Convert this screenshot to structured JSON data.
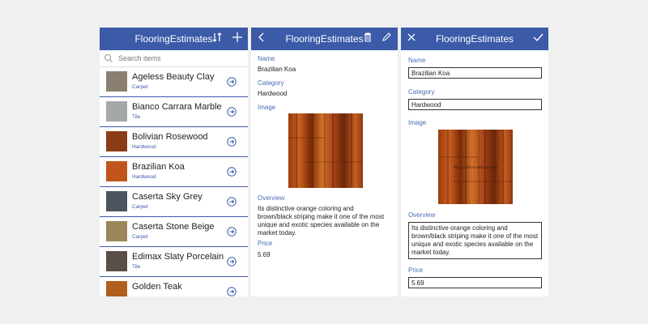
{
  "app_title": "FlooringEstimates",
  "list_screen": {
    "search_placeholder": "Search items",
    "items": [
      {
        "name": "Ageless Beauty Clay",
        "category": "Carpet",
        "swatch": "#8a7f70"
      },
      {
        "name": "Bianco Carrara Marble",
        "category": "Tile",
        "swatch": "#a3a8a8"
      },
      {
        "name": "Bolivian Rosewood",
        "category": "Hardwood",
        "swatch": "#8a3d14"
      },
      {
        "name": "Brazilian Koa",
        "category": "Hardwood",
        "swatch": "#c2551c"
      },
      {
        "name": "Caserta Sky Grey",
        "category": "Carpet",
        "swatch": "#4a5560"
      },
      {
        "name": "Caserta Stone Beige",
        "category": "Carpet",
        "swatch": "#9a8658"
      },
      {
        "name": "Edimax Slaty Porcelain",
        "category": "Tile",
        "swatch": "#5a4e48"
      },
      {
        "name": "Golden Teak",
        "category": "",
        "swatch": "#b0601c"
      }
    ]
  },
  "detail_screen": {
    "name_label": "Name",
    "name_value": "Brazilian Koa",
    "category_label": "Category",
    "category_value": "Hardwood",
    "image_label": "Image",
    "overview_label": "Overview",
    "overview_lines": [
      "Its distinctive orange coloring and",
      "brown/black striping make it one of the most",
      "unique and exotic species available on the",
      "market today."
    ],
    "price_label": "Price",
    "price_value": "5.69"
  },
  "edit_screen": {
    "name_label": "Name",
    "name_value": "Brazilian Koa",
    "category_label": "Category",
    "category_value": "Hardwood",
    "image_label": "Image",
    "image_overlay_text": "Tap or click to add a picture",
    "overview_label": "Overview",
    "overview_lines": [
      "Its distinctive orange coloring and",
      "brown/black striping make it one of the most",
      "unique and exotic species available on the",
      "market today."
    ],
    "price_label": "Price",
    "price_value": "5.69"
  },
  "colors": {
    "header": "#3b5aa8",
    "accent": "#4a6cb5"
  },
  "icons": {
    "list_header": [
      "sort-icon",
      "add-icon"
    ],
    "detail_header": [
      "back-icon",
      "trash-icon",
      "edit-pencil-icon"
    ],
    "edit_header": [
      "close-icon",
      "checkmark-icon"
    ]
  }
}
